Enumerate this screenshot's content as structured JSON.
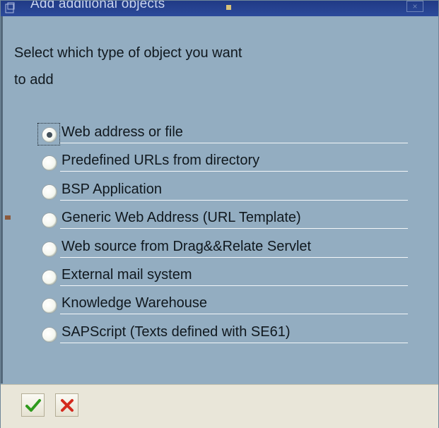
{
  "window": {
    "title": "Add additional objects",
    "close_icon": "close-icon",
    "close_glyph": "×"
  },
  "instruction": {
    "line1": "Select which type of object you want",
    "line2": "to add"
  },
  "options": [
    {
      "label": "Web address or file",
      "checked": true
    },
    {
      "label": "Predefined URLs from directory",
      "checked": false
    },
    {
      "label": "BSP Application",
      "checked": false
    },
    {
      "label": "Generic Web Address (URL Template)",
      "checked": false
    },
    {
      "label": "Web source from Drag&&Relate Servlet",
      "checked": false
    },
    {
      "label": "External mail system",
      "checked": false
    },
    {
      "label": "Knowledge Warehouse",
      "checked": false
    },
    {
      "label": "SAPScript (Texts defined with SE61)",
      "checked": false
    }
  ],
  "footer": {
    "confirm_icon": "checkmark-icon",
    "cancel_icon": "cancel-x-icon"
  },
  "colors": {
    "dialog_bg": "#93adc1",
    "titlebar": "#203a86",
    "footer_bg": "#e9e6d9",
    "confirm_green": "#2e9a1c",
    "cancel_red": "#d42a1e"
  }
}
